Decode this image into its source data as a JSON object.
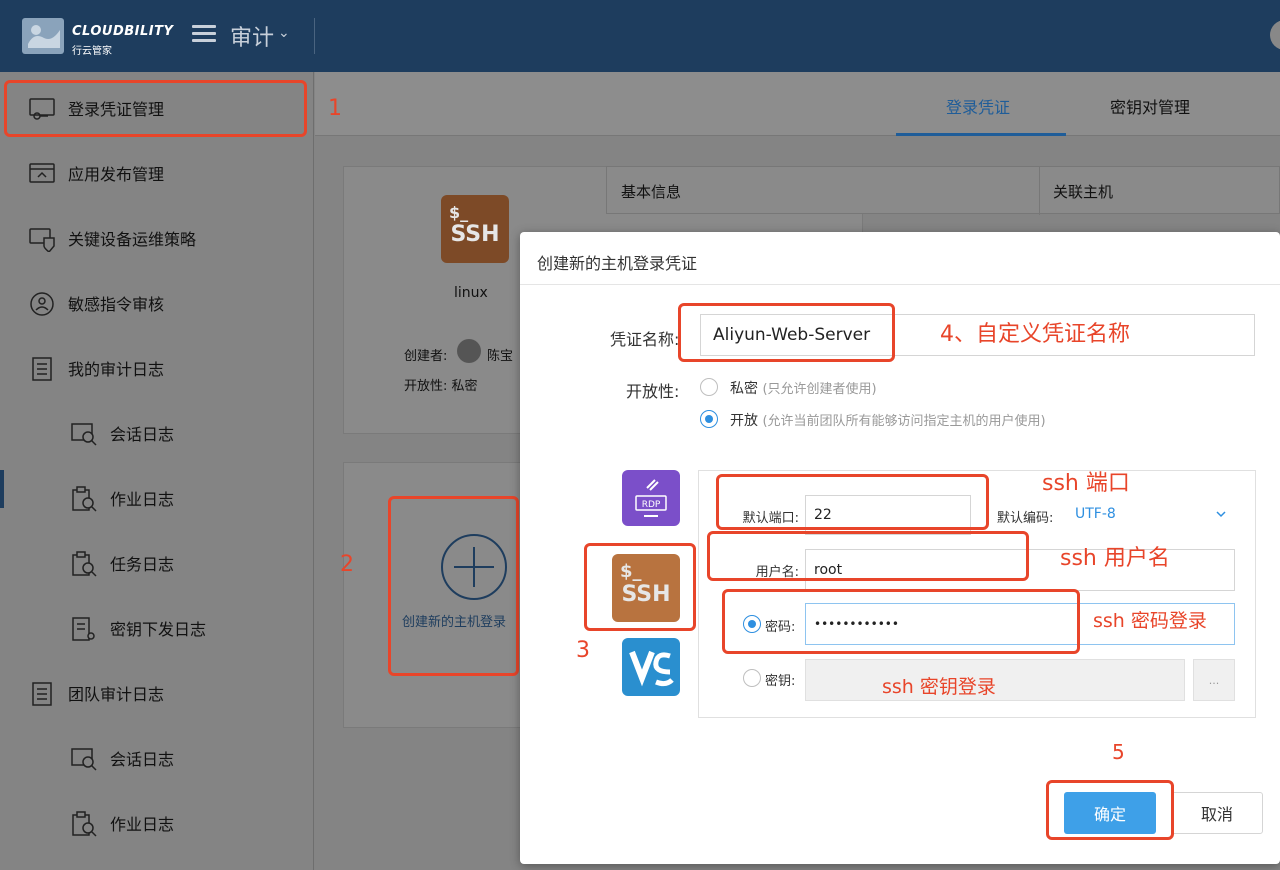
{
  "header": {
    "brand": "CLOUDBILITY",
    "brand_sub": "行云管家",
    "menu_title": "审计",
    "menu_chevron": "⌄"
  },
  "sidebar": {
    "items": [
      {
        "label": "登录凭证管理",
        "icon": "credential-icon"
      },
      {
        "label": "应用发布管理",
        "icon": "app-publish-icon"
      },
      {
        "label": "关键设备运维策略",
        "icon": "device-policy-icon"
      },
      {
        "label": "敏感指令审核",
        "icon": "command-audit-icon"
      },
      {
        "label": "我的审计日志",
        "icon": "audit-log-icon"
      },
      {
        "label": "会话日志",
        "icon": "session-log-icon"
      },
      {
        "label": "作业日志",
        "icon": "job-log-icon"
      },
      {
        "label": "任务日志",
        "icon": "task-log-icon"
      },
      {
        "label": "密钥下发日志",
        "icon": "key-log-icon"
      },
      {
        "label": "团队审计日志",
        "icon": "team-log-icon"
      },
      {
        "label": "会话日志",
        "icon": "session-log-icon"
      },
      {
        "label": "作业日志",
        "icon": "job-log-icon"
      }
    ]
  },
  "main": {
    "tabs": [
      {
        "label": "登录凭证",
        "active": true
      },
      {
        "label": "密钥对管理",
        "active": false
      }
    ],
    "card": {
      "icon_top": "$_",
      "icon_bottom": "SSH",
      "name": "linux",
      "creator_label": "创建者:",
      "creator_name": "陈宝",
      "openness": "开放性: 私密"
    },
    "table_headers": [
      "基本信息",
      "关联主机"
    ],
    "add_card_label": "创建新的主机登录"
  },
  "dialog": {
    "title": "创建新的主机登录凭证",
    "name_label": "凭证名称:",
    "name_value": "Aliyun-Web-Server",
    "openness_label": "开放性:",
    "private_label": "私密",
    "private_hint": "(只允许创建者使用)",
    "public_label": "开放",
    "public_hint": "(允许当前团队所有能够访问指定主机的用户使用)",
    "protocols": [
      "RDP",
      "SSH",
      "VNC"
    ],
    "ssh_tile_top": "$_",
    "ssh_tile_bottom": "SSH",
    "port_label": "默认端口:",
    "port_value": "22",
    "encoding_label": "默认编码:",
    "encoding_value": "UTF-8",
    "username_label": "用户名:",
    "username_value": "root",
    "password_label": "密码:",
    "password_value": "••••••••••••",
    "key_label": "密钥:",
    "key_browse": "...",
    "confirm_label": "确定",
    "cancel_label": "取消"
  },
  "annotations": {
    "step1": "1",
    "step2": "2",
    "step3": "3",
    "step4": "4、自定义凭证名称",
    "step5": "5",
    "ssh_port": "ssh 端口",
    "ssh_user": "ssh 用户名",
    "ssh_pw": "ssh 密码登录",
    "ssh_key": "ssh 密钥登录"
  },
  "colors": {
    "header_bg": "#1e3d5e",
    "accent_blue": "#3ea0e8",
    "annotation_red": "#e8452a",
    "ssh_brown": "#b8733f",
    "rdp_purple": "#7b4fc9",
    "vnc_blue": "#2a8fcf"
  }
}
